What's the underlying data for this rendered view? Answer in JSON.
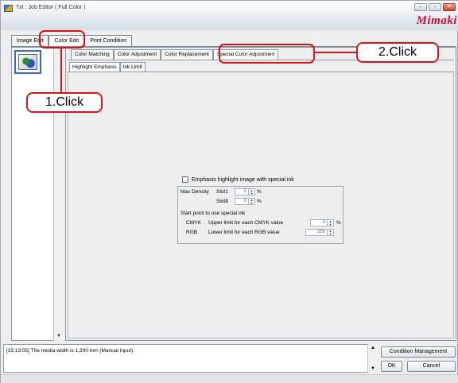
{
  "window": {
    "title": "TxI : Job Editor ( Full Color )",
    "brand": "Mimaki",
    "buttons": {
      "minimize": "–",
      "maximize": "▫",
      "close": "✕"
    }
  },
  "main_tabs": [
    "Image Edit",
    "Color Edit",
    "Print Condition"
  ],
  "color_tabs": [
    "Color Matching",
    "Color Adjustment",
    "Color Replacement",
    "Special Color Adjustment"
  ],
  "special_tabs": [
    "Highlight Emphasis",
    "Ink Limit"
  ],
  "form": {
    "emphasis_label": "Emphasis highlight image with special ink",
    "max_density_label": "Max Density",
    "slot1_label": "Slot1",
    "slot1_value": "0",
    "slot8_label": "Slot8",
    "slot8_value": "0",
    "percent": "%",
    "start_point_label": "Start point to use special ink",
    "cmyk_label": "CMYK",
    "cmyk_desc": "Upper limit for each CMYK value",
    "cmyk_value": "0",
    "rgb_label": "RGB",
    "rgb_desc": "Lower limit for each RGB value",
    "rgb_value": "255"
  },
  "log": {
    "message": "[15:13:05] The media width is 1,200 mm (Manual Input)."
  },
  "bottom_buttons": {
    "condition": "Condition Management",
    "ok": "OK",
    "cancel": "Cancel"
  },
  "annotations": {
    "step1": "1.Click",
    "step2": "2.Click"
  },
  "colors": {
    "annotation": "#d7141a",
    "brand": "#c8102e",
    "selection": "#2f6ad0"
  }
}
